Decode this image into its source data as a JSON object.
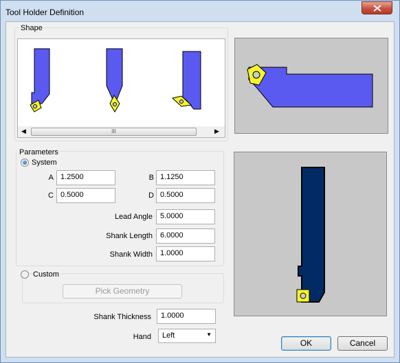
{
  "window": {
    "title": "Tool Holder Definition"
  },
  "shape": {
    "label": "Shape",
    "scroll_left_icon": "arrow-left-icon",
    "scroll_right_icon": "arrow-right-icon",
    "scroll_grip": "III"
  },
  "parameters": {
    "label": "Parameters",
    "system_label": "System",
    "system_selected": true,
    "fields": {
      "A": {
        "label": "A",
        "value": "1.2500"
      },
      "B": {
        "label": "B",
        "value": "1.1250"
      },
      "C": {
        "label": "C",
        "value": "0.5000"
      },
      "D": {
        "label": "D",
        "value": "0.5000"
      },
      "lead_angle": {
        "label": "Lead Angle",
        "value": "5.0000"
      },
      "shank_length": {
        "label": "Shank Length",
        "value": "6.0000"
      },
      "shank_width": {
        "label": "Shank Width",
        "value": "1.0000"
      }
    },
    "custom_label": "Custom",
    "custom_selected": false,
    "pick_geometry_label": "Pick Geometry"
  },
  "shank_thickness": {
    "label": "Shank Thickness",
    "value": "1.0000"
  },
  "hand": {
    "label": "Hand",
    "value": "Left"
  },
  "buttons": {
    "ok": "OK",
    "cancel": "Cancel"
  },
  "colors": {
    "holder": "#5a5af0",
    "holder_dark": "#022b66",
    "insert": "#f5f52a"
  }
}
